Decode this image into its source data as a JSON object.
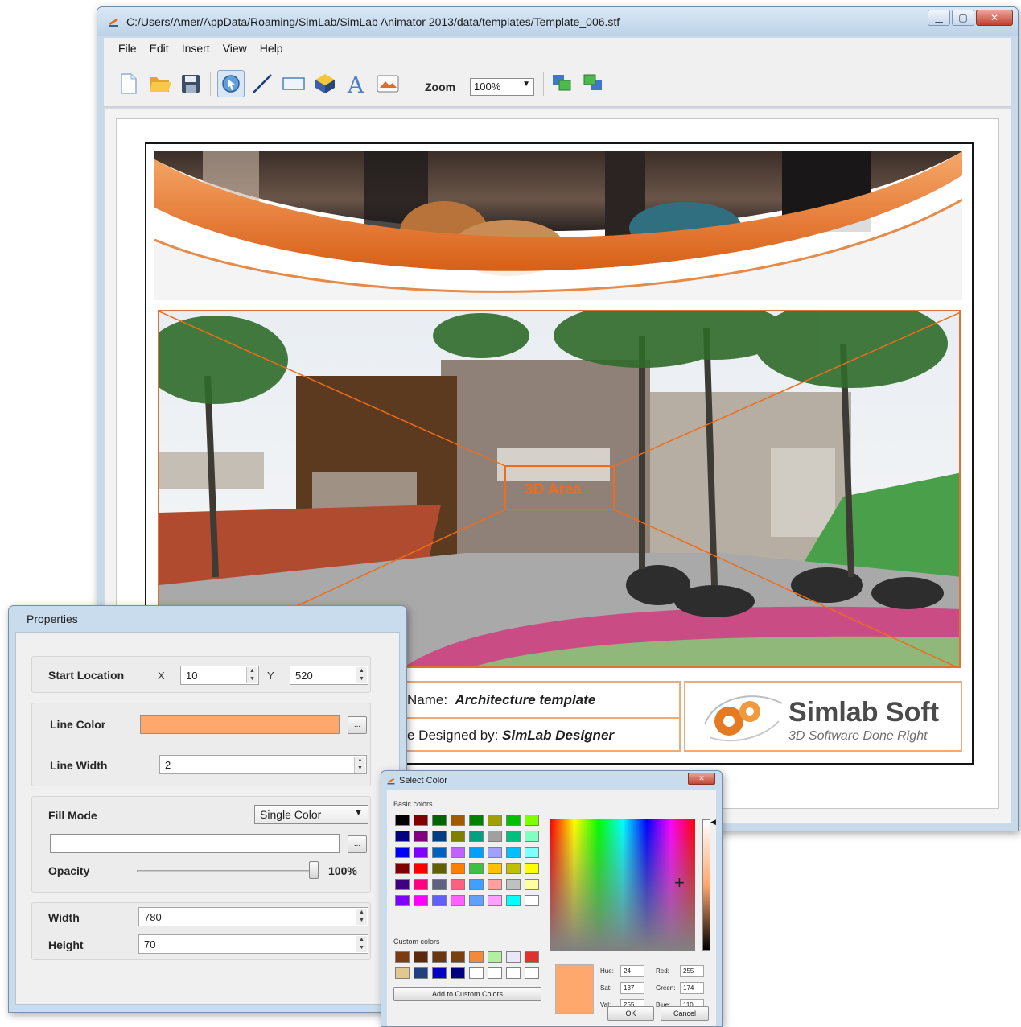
{
  "window": {
    "title": "C:/Users/Amer/AppData/Roaming/SimLab/SimLab Animator 2013/data/templates/Template_006.stf",
    "minimize": "▁",
    "maximize": "▢",
    "close": "✕"
  },
  "menu": [
    "File",
    "Edit",
    "Insert",
    "View",
    "Help"
  ],
  "toolbar": {
    "zoom_label": "Zoom",
    "zoom_value": "100%",
    "tools": [
      "new-file-icon",
      "open-folder-icon",
      "save-icon",
      "select-tool-icon",
      "line-tool-icon",
      "rectangle-tool-icon",
      "3d-area-tool-icon",
      "text-tool-icon",
      "image-tool-icon",
      "bring-forward-icon",
      "send-backward-icon"
    ]
  },
  "template": {
    "area_label": "3D Area",
    "name_label": "Name:",
    "name_value": "Architecture template",
    "designed_label": "e Designed by:",
    "designed_value": "SimLab Designer",
    "logo_name": "Simlab Soft",
    "logo_tagline": "3D Software Done Right",
    "accent": "#ee6c1c"
  },
  "properties": {
    "title": "Properties",
    "start_location_label": "Start Location",
    "x_label": "X",
    "x_value": "10",
    "y_label": "Y",
    "y_value": "520",
    "line_color_label": "Line Color",
    "line_color": "#ffa86e",
    "line_width_label": "Line Width",
    "line_width": "2",
    "fill_mode_label": "Fill Mode",
    "fill_mode": "Single Color",
    "opacity_label": "Opacity",
    "opacity_value": "100%",
    "opacity_fraction": 1.0,
    "width_label": "Width",
    "width_value": "780",
    "height_label": "Height",
    "height_value": "70",
    "dots": "..."
  },
  "color_dialog": {
    "title": "Select Color",
    "close": "✕",
    "basic_label": "Basic colors",
    "custom_label": "Custom colors",
    "add_custom": "Add to Custom Colors",
    "ok": "OK",
    "cancel": "Cancel",
    "hue_label": "Hue:",
    "hue": "24",
    "sat_label": "Sat:",
    "sat": "137",
    "val_label": "Val:",
    "val": "255",
    "red_label": "Red:",
    "red": "255",
    "green_label": "Green:",
    "green": "174",
    "blue_label": "Blue:",
    "blue": "110",
    "selected_color": "#ffa86e",
    "basic_colors": [
      "#000000",
      "#800000",
      "#006400",
      "#a05a00",
      "#008000",
      "#a0a000",
      "#00c000",
      "#80ff00",
      "#000080",
      "#800080",
      "#004080",
      "#808000",
      "#00a080",
      "#a0a0a0",
      "#00c080",
      "#80ffc0",
      "#0000ff",
      "#8000ff",
      "#0060c0",
      "#c060ff",
      "#00a0ff",
      "#a0a0ff",
      "#00c0ff",
      "#80ffff",
      "#800000",
      "#ff0000",
      "#606000",
      "#ff8000",
      "#40c040",
      "#ffc000",
      "#c0c000",
      "#ffff00",
      "#400080",
      "#ff0080",
      "#606080",
      "#ff6080",
      "#40a0ff",
      "#ffa0a0",
      "#c0c0c0",
      "#ffffa0",
      "#8000ff",
      "#ff00ff",
      "#6060ff",
      "#ff60ff",
      "#60a0ff",
      "#ffa0ff",
      "#00ffff",
      "#ffffff"
    ],
    "custom_colors": [
      "#7a3c10",
      "#5a2a0a",
      "#6a3810",
      "#7a4010",
      "#f28a3a",
      "#b0f0a0",
      "#e8e8f8",
      "#e03030",
      "#e0c890",
      "#204080",
      "#0000c0",
      "#000080",
      "#ffffff",
      "#ffffff",
      "#ffffff",
      "#ffffff"
    ]
  }
}
